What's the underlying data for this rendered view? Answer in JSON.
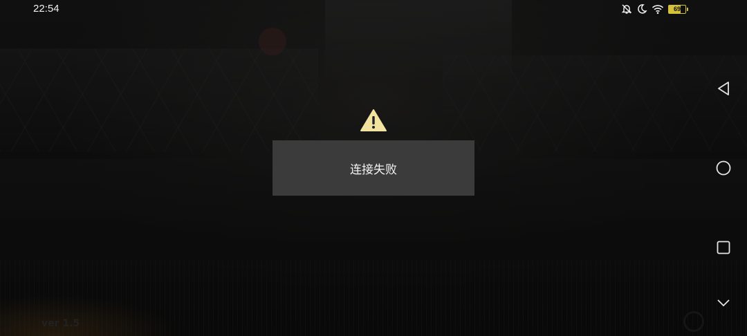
{
  "status_bar": {
    "time": "22:54",
    "icons": [
      "mute-icon",
      "moon-icon",
      "wifi-icon",
      "battery-icon"
    ],
    "battery_level": "69",
    "battery_fraction": 0.69,
    "battery_color": "#d4c23a"
  },
  "game": {
    "version": "ver 1.5"
  },
  "dialog": {
    "icon": "warning-icon",
    "message": "连接失败",
    "background": "#3b3b3b"
  },
  "nav_bar": {
    "buttons": [
      "back-icon",
      "home-icon",
      "recents-icon",
      "hide-nav-icon"
    ]
  }
}
